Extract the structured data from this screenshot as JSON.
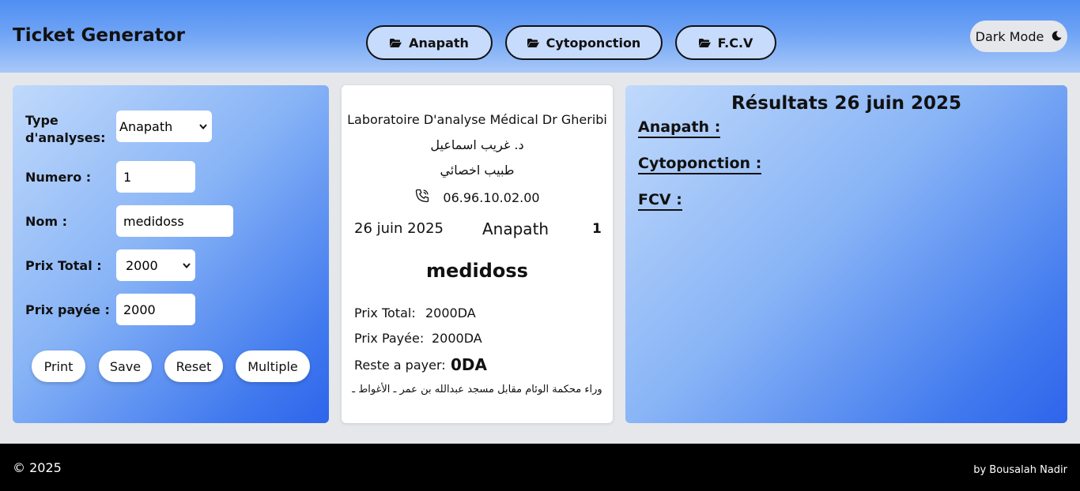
{
  "header": {
    "title": "Ticket Generator",
    "tabs": [
      {
        "label": "Anapath",
        "icon": "folder-open-icon"
      },
      {
        "label": "Cytoponction",
        "icon": "folder-open-icon"
      },
      {
        "label": "F.C.V",
        "icon": "folder-open-icon"
      }
    ],
    "dark_mode_label": "Dark Mode",
    "dark_mode_icon": "moon-icon"
  },
  "form": {
    "type_label": "Type d'analyses:",
    "type_value": "Anapath",
    "numero_label": "Numero :",
    "numero_value": "1",
    "nom_label": "Nom :",
    "nom_value": "medidoss",
    "prix_total_label": "Prix Total :",
    "prix_total_value": "2000",
    "prix_payee_label": "Prix payée :",
    "prix_payee_value": "2000",
    "buttons": {
      "print": "Print",
      "save": "Save",
      "reset": "Reset",
      "multiple": "Multiple"
    }
  },
  "ticket": {
    "lab_name": "Laboratoire D'analyse Médical Dr Gheribi",
    "doctor_ar": "د. غريب اسماعيل",
    "specialty_ar": "طبيب اخصائي",
    "phone": "06.96.10.02.00",
    "phone_icon": "phone-icon",
    "date": "26 juin 2025",
    "type": "Anapath",
    "number": "1",
    "patient_name": "medidoss",
    "prix_total_label": "Prix Total:",
    "prix_total_value": "2000DA",
    "prix_payee_label": "Prix Payée:",
    "prix_payee_value": "2000DA",
    "reste_label": "Reste a payer:",
    "reste_value": "0DA",
    "address_ar": "وراء محكمة الوئام مقابل مسجد عبدالله بن عمر ـ الأغواط ـ"
  },
  "results": {
    "title": "Résultats 26 juin 2025",
    "sections": [
      "Anapath :",
      "Cytoponction :",
      "FCV :"
    ]
  },
  "footer": {
    "copyright": "© 2025",
    "author": "by Bousalah Nadir"
  },
  "colors": {
    "header_top": "#4f8ff2",
    "panel_gradient_light": "#c0d9fb",
    "panel_gradient_dark": "#2e64eb",
    "footer_bg": "#000000",
    "tab_bg": "#c7dbfc"
  }
}
